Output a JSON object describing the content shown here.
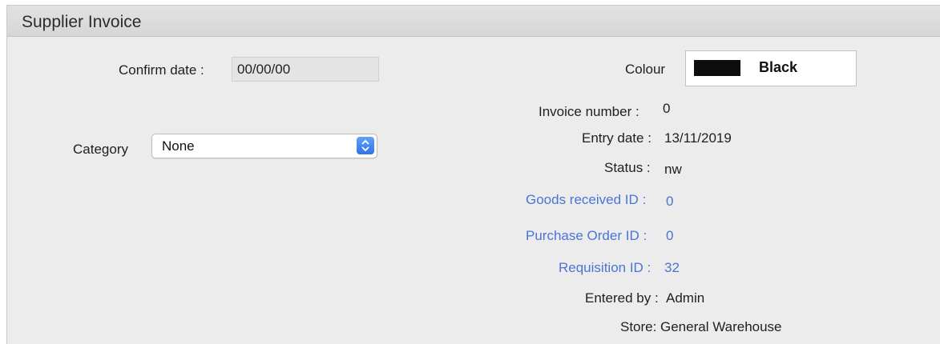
{
  "window": {
    "title": "Supplier Invoice"
  },
  "left": {
    "confirm_date_label": "Confirm date :",
    "confirm_date_value": "00/00/00",
    "category_label": "Category",
    "category_value": "None"
  },
  "right": {
    "colour_label": "Colour",
    "colour_value": "Black",
    "colour_swatch": "#0d0d0d",
    "fields": [
      {
        "label": "Invoice number :",
        "value": "0"
      },
      {
        "label": "Entry date :",
        "value": "13/11/2019"
      },
      {
        "label": "Status :",
        "value": "nw"
      },
      {
        "label": "Goods received ID :",
        "value": "0"
      },
      {
        "label": "Purchase Order ID :",
        "value": "0"
      },
      {
        "label": "Requisition ID :",
        "value": "32"
      },
      {
        "label": "Entered by :",
        "value": "Admin"
      },
      {
        "label": "Store:",
        "value": "General Warehouse"
      }
    ]
  },
  "icons": {
    "select_arrow": "chevron-up-down-icon"
  },
  "colors": {
    "link": "#4a74d6",
    "select_accent": "#2f74e8"
  }
}
